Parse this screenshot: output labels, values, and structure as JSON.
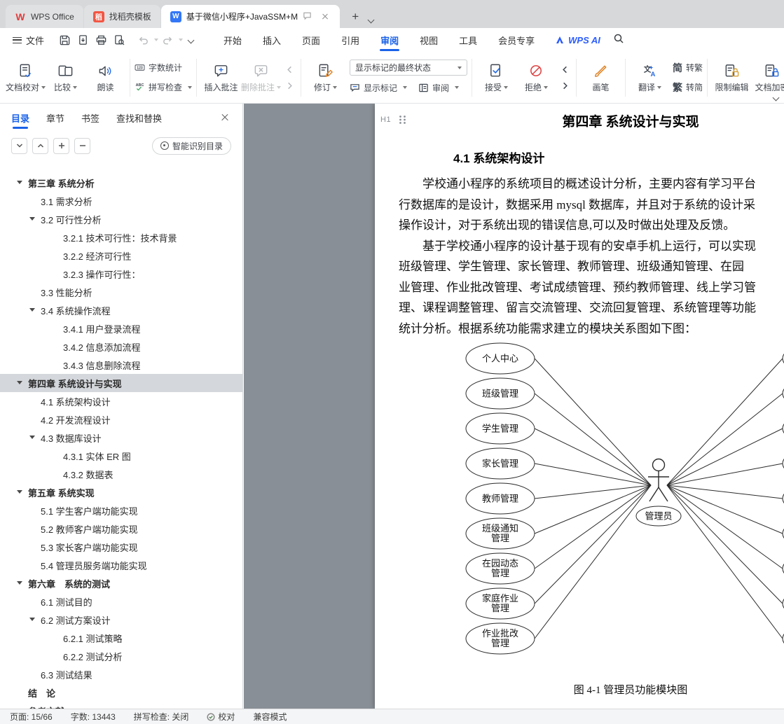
{
  "accent": {
    "blue": "#1b62e8",
    "red": "#de4040"
  },
  "tabbar": {
    "tabs": [
      {
        "label": "WPS Office"
      },
      {
        "label": "找稻壳模板"
      },
      {
        "label": "基于微信小程序+JavaSSM+M"
      }
    ],
    "wps_logo_glyph": "W",
    "docer_glyph": "稻",
    "word_glyph": "W"
  },
  "menubar": {
    "file": "文件",
    "tabs": [
      "开始",
      "插入",
      "页面",
      "引用",
      "审阅",
      "视图",
      "工具",
      "会员专享"
    ],
    "active_tab": "审阅",
    "wps_ai": "WPS AI"
  },
  "ribbon": {
    "doc_proof": "文档校对",
    "compare": "比较",
    "read_aloud": "朗读",
    "word_count": "字数统计",
    "word_count_icon_text": "123",
    "spell_check": "拼写检查",
    "spell_icon_text": "ABC",
    "insert_comment": "插入批注",
    "delete_comment": "删除批注",
    "track_changes": "修订",
    "markup_state_value": "显示标记的最终状态",
    "show_markup": "显示标记",
    "review_pane": "审阅",
    "accept": "接受",
    "reject": "拒绝",
    "brush": "画笔",
    "translate": "翻译",
    "translate_icon_zh": "文",
    "translate_icon_a": "A",
    "jian_icon": "简",
    "to_trad": "转繁",
    "fan_icon": "繁",
    "to_simp": "转简",
    "restrict_edit": "限制编辑",
    "doc_encrypt": "文档加密"
  },
  "sidebar": {
    "tabs": [
      "目录",
      "章节",
      "书签",
      "查找和替换"
    ],
    "active_tab": "目录",
    "smart_toc": "智能识别目录",
    "toc": [
      {
        "label": "第三章 系统分析",
        "level": 1,
        "expand": true
      },
      {
        "label": "3.1 需求分析",
        "level": 2
      },
      {
        "label": "3.2 可行性分析",
        "level": 2,
        "expand": true
      },
      {
        "label": "3.2.1 技术可行性：技术背景",
        "level": 3
      },
      {
        "label": "3.2.2 经济可行性",
        "level": 3
      },
      {
        "label": "3.2.3 操作可行性：",
        "level": 3
      },
      {
        "label": "3.3 性能分析",
        "level": 2
      },
      {
        "label": "3.4 系统操作流程",
        "level": 2,
        "expand": true
      },
      {
        "label": "3.4.1 用户登录流程",
        "level": 3
      },
      {
        "label": "3.4.2 信息添加流程",
        "level": 3
      },
      {
        "label": "3.4.3 信息删除流程",
        "level": 3
      },
      {
        "label": "第四章 系统设计与实现",
        "level": 1,
        "expand": true,
        "selected": true
      },
      {
        "label": "4.1 系统架构设计",
        "level": 2
      },
      {
        "label": "4.2 开发流程设计",
        "level": 2
      },
      {
        "label": "4.3 数据库设计",
        "level": 2,
        "expand": true
      },
      {
        "label": "4.3.1 实体 ER 图",
        "level": 3
      },
      {
        "label": "4.3.2 数据表",
        "level": 3
      },
      {
        "label": "第五章 系统实现",
        "level": 1,
        "expand": true
      },
      {
        "label": "5.1 学生客户端功能实现",
        "level": 2
      },
      {
        "label": "5.2 教师客户端功能实现",
        "level": 2
      },
      {
        "label": "5.3 家长客户端功能实现",
        "level": 2
      },
      {
        "label": "5.4 管理员服务端功能实现",
        "level": 2
      },
      {
        "label": "第六章　系统的测试",
        "level": 1,
        "expand": true
      },
      {
        "label": "6.1 测试目的",
        "level": 2
      },
      {
        "label": "6.2 测试方案设计",
        "level": 2,
        "expand": true
      },
      {
        "label": "6.2.1 测试策略",
        "level": 3
      },
      {
        "label": "6.2.2 测试分析",
        "level": 3
      },
      {
        "label": "6.3 测试结果",
        "level": 2
      },
      {
        "label": "结　论",
        "level": 1
      },
      {
        "label": "参考文献",
        "level": 1
      }
    ]
  },
  "document": {
    "anchor_label": "H1",
    "chapter_title": "第四章 系统设计与实现",
    "section_heading": "4.1 系统架构设计",
    "para1_lines": [
      "学校通小程序的系统项目的概述设计分析，主要内容有学习平台",
      "行数据库的是设计，数据采用 mysql 数据库，并且对于系统的设计采",
      "操作设计，对于系统出现的错误信息,可以及时做出处理及反馈。"
    ],
    "para2_lines": [
      "基于学校通小程序的设计基于现有的安卓手机上运行，可以实现",
      "班级管理、学生管理、家长管理、教师管理、班级通知管理、在园",
      "业管理、作业批改管理、考试成绩管理、预约教师管理、线上学习管",
      "理、课程调整管理、留言交流管理、交流回复管理、系统管理等功能",
      "统计分析。根据系统功能需求建立的模块关系图如下图："
    ],
    "figure_caption": "图 4-1 管理员功能模块图"
  },
  "diagram": {
    "modules": [
      {
        "lines": [
          "个人中心"
        ]
      },
      {
        "lines": [
          "班级管理"
        ]
      },
      {
        "lines": [
          "学生管理"
        ]
      },
      {
        "lines": [
          "家长管理"
        ]
      },
      {
        "lines": [
          "教师管理"
        ]
      },
      {
        "lines": [
          "班级通知",
          "管理"
        ]
      },
      {
        "lines": [
          "在园动态",
          "管理"
        ]
      },
      {
        "lines": [
          "家庭作业",
          "管理"
        ]
      },
      {
        "lines": [
          "作业批改",
          "管理"
        ]
      }
    ],
    "actor": "管理员"
  },
  "statusbar": {
    "page": "页面: 15/66",
    "words": "字数: 13443",
    "spell": "拼写检查: 关闭",
    "proof": "校对",
    "mode": "兼容模式"
  }
}
